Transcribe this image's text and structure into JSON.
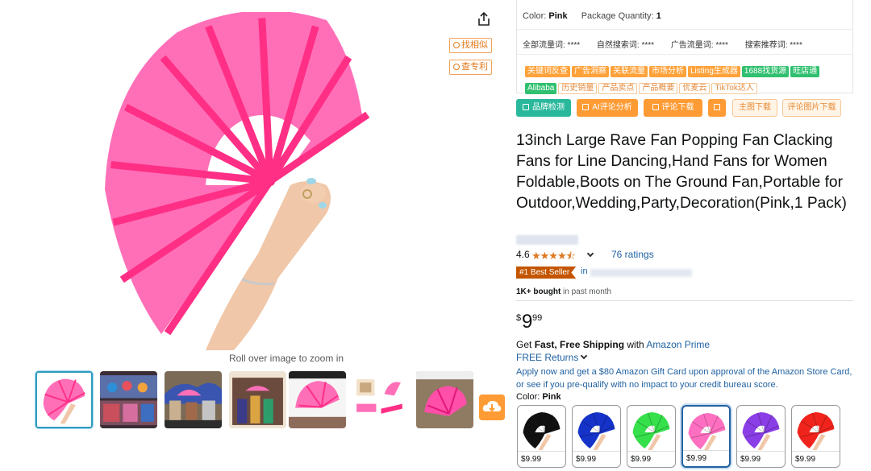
{
  "variation_summary": {
    "color_label": "Color:",
    "color_value": "Pink",
    "qty_label": "Package Quantity:",
    "qty_value": "1"
  },
  "traffic_stats": [
    "全部流量词: ****",
    "自然搜索词: ****",
    "广告流量词: ****",
    "搜索推荐词: ****"
  ],
  "plugin_tags": [
    {
      "label": "关键词反查",
      "style": "o"
    },
    {
      "label": "广告洞察",
      "style": "o"
    },
    {
      "label": "关联流量",
      "style": "o"
    },
    {
      "label": "市场分析",
      "style": "o"
    },
    {
      "label": "Listing生成器",
      "style": "o"
    },
    {
      "label": "1688找货源",
      "style": "g"
    },
    {
      "label": "旺店通",
      "style": "g"
    },
    {
      "label": "Alibaba",
      "style": "g"
    },
    {
      "label": "历史销量",
      "style": "w"
    },
    {
      "label": "产品卖点",
      "style": "w"
    },
    {
      "label": "产品概要",
      "style": "w"
    },
    {
      "label": "优麦云",
      "style": "w"
    },
    {
      "label": "TikTok达人",
      "style": "w"
    }
  ],
  "side_tools": {
    "find_similar": "找相似",
    "check_patent": "查专利"
  },
  "actions": {
    "brand_check": "品牌检测",
    "ai_review": "AI评论分析",
    "review_download": "评论下载",
    "main_image_download": "主图下载",
    "review_image_download": "评论图片下载"
  },
  "product": {
    "title": "13inch Large Rave Fan Popping Fan Clacking Fans for Line Dancing,Hand Fans for Women Foldable,Boots on The Ground Fan,Portable for Outdoor,Wedding,Party,Decoration(Pink,1 Pack)",
    "rating": "4.6",
    "stars": "★★★★⯪",
    "ratings_count": "76 ratings",
    "best_seller": "#1 Best Seller",
    "best_seller_in": "in",
    "bought_bold": "1K+ bought",
    "bought_rest": " in past month",
    "price_currency": "$",
    "price_whole": "9",
    "price_fraction": "99"
  },
  "shipping": {
    "get": "Get ",
    "fast": "Fast, Free Shipping",
    "with": " with ",
    "prime": "Amazon Prime",
    "free_returns": "FREE Returns"
  },
  "card_offer": "Apply now and get a $80 Amazon Gift Card upon approval of the Amazon Store Card, or see if you pre-qualify with no impact to your credit bureau score.",
  "color_selector": {
    "label": "Color:",
    "selected": "Pink"
  },
  "swatches": [
    {
      "color": "#111111",
      "price": "$9.99"
    },
    {
      "color": "#1533c9",
      "price": "$9.99"
    },
    {
      "color": "#35e04a",
      "price": "$9.99"
    },
    {
      "color": "#ff6fc1",
      "price": "$9.99"
    },
    {
      "color": "#8a3ee6",
      "price": "$9.99"
    },
    {
      "color": "#f0241c",
      "price": "$9.99"
    }
  ],
  "gallery": {
    "zoom_hint": "Roll over image to zoom in",
    "thumb_count": 7
  },
  "colors": {
    "fan_pink": "#ff6fb8",
    "fan_rib": "#ff2f86",
    "accent_orange": "#ff9b34",
    "link_blue": "#2162a1"
  }
}
